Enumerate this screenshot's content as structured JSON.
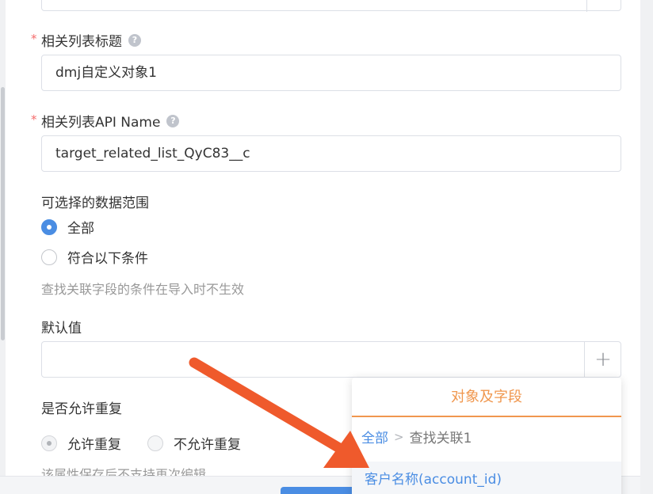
{
  "form": {
    "related_list_title_label": "相关列表标题",
    "related_list_title_value": "dmj自定义对象1",
    "api_name_label": "相关列表API Name",
    "api_name_value": "target_related_list_QyC83__c",
    "required_mark": "*",
    "help_glyph": "?",
    "data_range_label": "可选择的数据范围",
    "range_options": [
      {
        "label": "全部",
        "checked": true
      },
      {
        "label": "符合以下条件",
        "checked": false
      }
    ],
    "range_hint": "查找关联字段的条件在导入时不生效",
    "default_value_label": "默认值",
    "default_value": "",
    "add_glyph": "+",
    "allow_duplicate_label": "是否允许重复",
    "duplicate_options": [
      {
        "label": "允许重复",
        "checked": true
      },
      {
        "label": "不允许重复",
        "checked": false
      }
    ],
    "duplicate_hint": "该属性保存后不支持再次编辑"
  },
  "popup": {
    "title": "对象及字段",
    "breadcrumb_root": "全部",
    "breadcrumb_sep": ">",
    "breadcrumb_current": "查找关联1",
    "items": [
      "客户名称(account_id)"
    ]
  },
  "colors": {
    "accent": "#4a8de3",
    "popup_accent": "#f0974e",
    "required": "#f56c6c",
    "annotation_arrow": "#ef5a2c"
  }
}
